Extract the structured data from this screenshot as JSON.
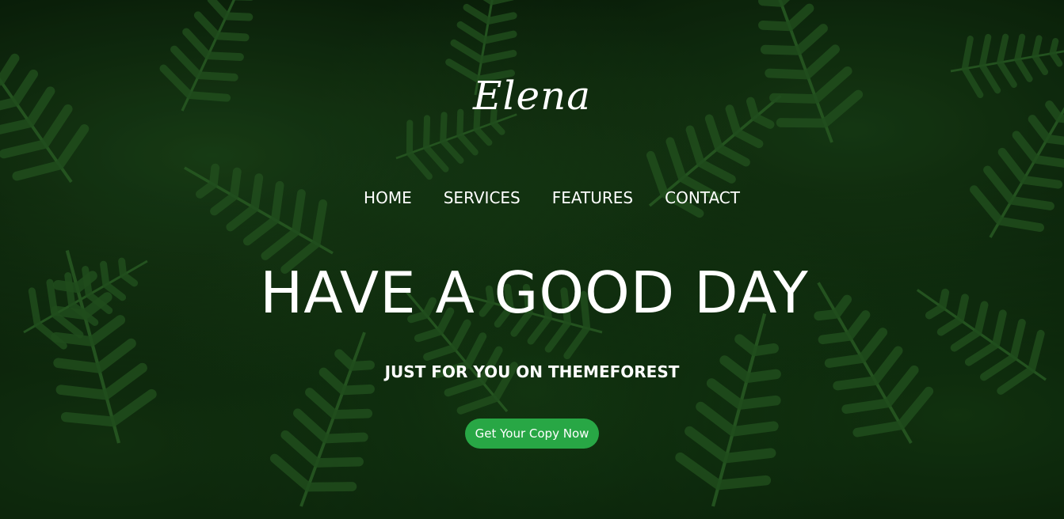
{
  "brand": {
    "logo_text": "Elena"
  },
  "nav": {
    "items": [
      {
        "label": "HOME"
      },
      {
        "label": "SERVICES"
      },
      {
        "label": "FEATURES"
      },
      {
        "label": "CONTACT"
      }
    ]
  },
  "hero": {
    "headline": "HAVE A GOOD DAY",
    "subheadline": "JUST FOR YOU ON THEMEFOREST",
    "cta_label": "Get Your Copy Now"
  },
  "colors": {
    "background": "#071a07",
    "fern_green": "#2e6e28",
    "cta_green": "#28a745",
    "text": "#ffffff"
  }
}
